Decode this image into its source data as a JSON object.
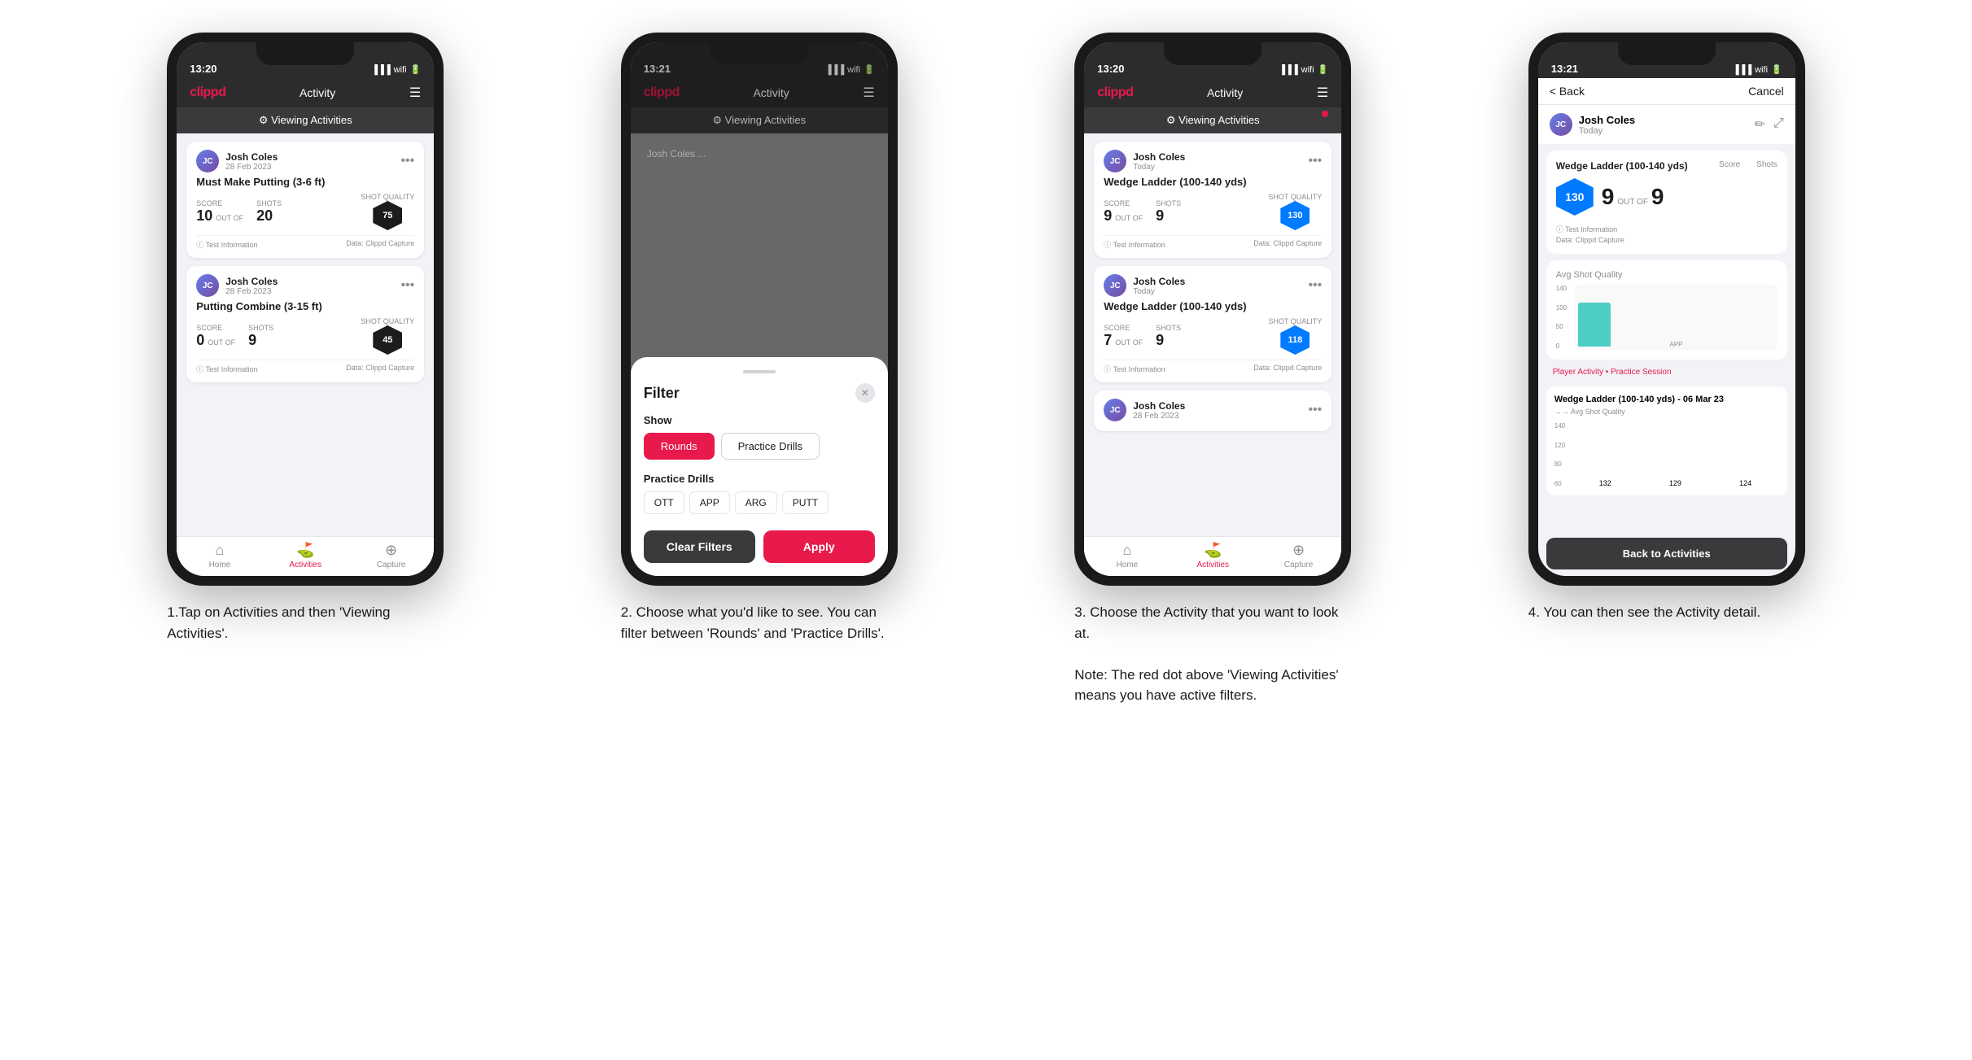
{
  "phones": [
    {
      "id": "phone1",
      "status_time": "13:20",
      "header_logo": "clippd",
      "header_title": "Activity",
      "viewing_bar_label": "⚙ Viewing Activities",
      "has_red_dot": false,
      "caption": "1.Tap on Activities and then 'Viewing Activities'.",
      "cards": [
        {
          "name": "Josh Coles",
          "date": "28 Feb 2023",
          "title": "Must Make Putting (3-6 ft)",
          "score_label": "Score",
          "shots_label": "Shots",
          "shot_quality_label": "Shot Quality",
          "score": "10",
          "out_of": "OUT OF",
          "shots": "20",
          "quality": "75",
          "quality_color": "dark"
        },
        {
          "name": "Josh Coles",
          "date": "28 Feb 2023",
          "title": "Putting Combine (3-15 ft)",
          "score_label": "Score",
          "shots_label": "Shots",
          "shot_quality_label": "Shot Quality",
          "score": "0",
          "out_of": "OUT OF",
          "shots": "9",
          "quality": "45",
          "quality_color": "dark"
        }
      ],
      "tabs": [
        {
          "label": "Home",
          "icon": "⌂",
          "active": false
        },
        {
          "label": "Activities",
          "icon": "♟",
          "active": true
        },
        {
          "label": "Capture",
          "icon": "⊕",
          "active": false
        }
      ]
    },
    {
      "id": "phone2",
      "status_time": "13:21",
      "header_logo": "clippd",
      "header_title": "Activity",
      "viewing_bar_label": "⚙ Viewing Activities",
      "has_red_dot": false,
      "is_filter_modal": true,
      "caption": "2. Choose what you'd like to see. You can filter between 'Rounds' and 'Practice Drills'.",
      "filter": {
        "title": "Filter",
        "show_label": "Show",
        "rounds_label": "Rounds",
        "practice_drills_label": "Practice Drills",
        "practice_drills_section": "Practice Drills",
        "pills": [
          "OTT",
          "APP",
          "ARG",
          "PUTT"
        ],
        "clear_label": "Clear Filters",
        "apply_label": "Apply"
      },
      "tabs": [
        {
          "label": "Home",
          "icon": "⌂",
          "active": false
        },
        {
          "label": "Activities",
          "icon": "♟",
          "active": true
        },
        {
          "label": "Capture",
          "icon": "⊕",
          "active": false
        }
      ]
    },
    {
      "id": "phone3",
      "status_time": "13:20",
      "header_logo": "clippd",
      "header_title": "Activity",
      "viewing_bar_label": "⚙ Viewing Activities",
      "has_red_dot": true,
      "caption": "3. Choose the Activity that you want to look at.\n\nNote: The red dot above 'Viewing Activities' means you have active filters.",
      "cards": [
        {
          "name": "Josh Coles",
          "date": "Today",
          "title": "Wedge Ladder (100-140 yds)",
          "score_label": "Score",
          "shots_label": "Shots",
          "shot_quality_label": "Shot Quality",
          "score": "9",
          "out_of": "OUT OF",
          "shots": "9",
          "quality": "130",
          "quality_color": "blue"
        },
        {
          "name": "Josh Coles",
          "date": "Today",
          "title": "Wedge Ladder (100-140 yds)",
          "score_label": "Score",
          "shots_label": "Shots",
          "shot_quality_label": "Shot Quality",
          "score": "7",
          "out_of": "OUT OF",
          "shots": "9",
          "quality": "118",
          "quality_color": "blue"
        },
        {
          "name": "Josh Coles",
          "date": "28 Feb 2023",
          "title": "",
          "score": "",
          "shots": "",
          "quality": ""
        }
      ],
      "tabs": [
        {
          "label": "Home",
          "icon": "⌂",
          "active": false
        },
        {
          "label": "Activities",
          "icon": "♟",
          "active": true
        },
        {
          "label": "Capture",
          "icon": "⊕",
          "active": false
        }
      ]
    },
    {
      "id": "phone4",
      "status_time": "13:21",
      "is_detail": true,
      "caption": "4. You can then see the Activity detail.",
      "back_label": "< Back",
      "cancel_label": "Cancel",
      "user_name": "Josh Coles",
      "user_date": "Today",
      "card_title": "Wedge Ladder (100-140 yds)",
      "score_label": "Score",
      "shots_label": "Shots",
      "score_value": "9",
      "out_of": "OUT OF",
      "shots_value": "9",
      "avg_shot_quality_label": "Avg Shot Quality",
      "quality_value": "130",
      "chart_y_labels": [
        "140",
        "100",
        "50",
        "0"
      ],
      "chart_x_label": "APP",
      "practice_session_label": "Player Activity • Practice Session",
      "activity_title": "Wedge Ladder (100-140 yds) - 06 Mar 23",
      "avg_shot_quality_label2": "→→ Avg Shot Quality",
      "bars": [
        {
          "value": 132,
          "label": ""
        },
        {
          "value": 129,
          "label": ""
        },
        {
          "value": 124,
          "label": ""
        }
      ],
      "back_to_activities": "Back to Activities",
      "dashed_value": "124"
    }
  ]
}
